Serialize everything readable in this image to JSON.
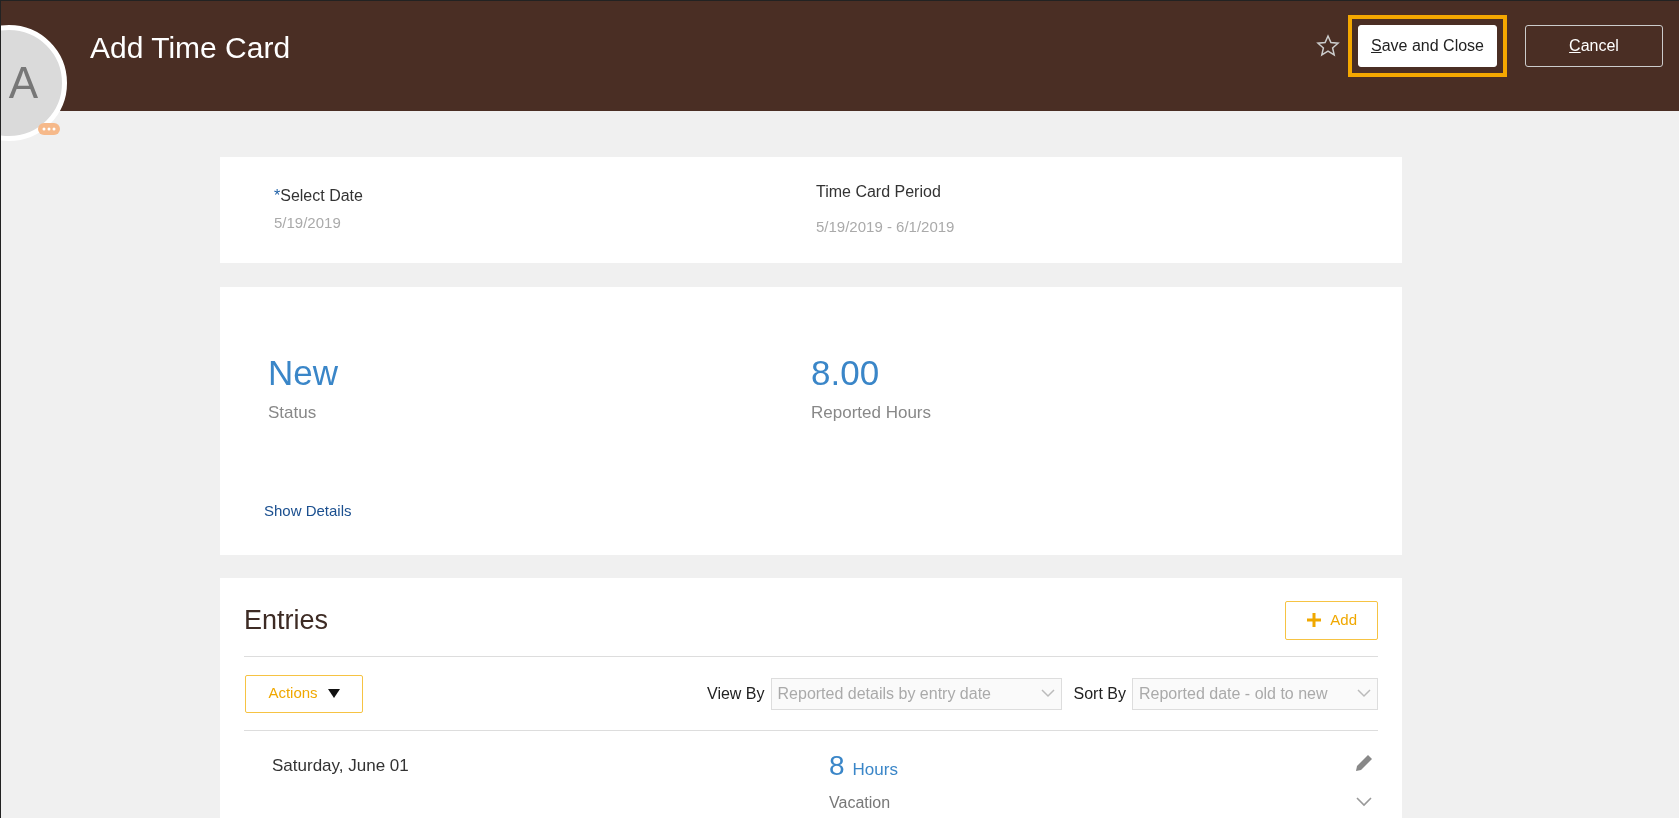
{
  "header": {
    "title": "Add Time Card",
    "avatar_initial": "A",
    "favorite": false,
    "buttons": [
      {
        "label": "Save and Close",
        "first_letter_underlined": true,
        "kind": "primary",
        "highlighted": true
      },
      {
        "label": "Cancel",
        "first_letter_underlined": true,
        "kind": "outline",
        "highlighted": false
      }
    ]
  },
  "period_card": {
    "fields": [
      {
        "label": "Select Date",
        "required": true,
        "required_marker": "*",
        "value": "5/19/2019"
      },
      {
        "label": "Time Card Period",
        "value": "5/19/2019 - 6/1/2019"
      }
    ]
  },
  "summary_card": {
    "metrics": [
      {
        "value": "New",
        "caption": "Status"
      },
      {
        "value": "8.00",
        "caption": "Reported Hours"
      }
    ],
    "link": "Show Details"
  },
  "entries": {
    "title": "Entries",
    "add_button": "Add",
    "actions_button": "Actions",
    "filters": [
      {
        "label": "View By",
        "value": "Reported details by entry date"
      },
      {
        "label": "Sort By",
        "value": "Reported date - old to new"
      }
    ],
    "rows": [
      {
        "date": "Saturday, June 01",
        "amount": "8",
        "unit": "Hours",
        "type": "Vacation"
      }
    ]
  }
}
